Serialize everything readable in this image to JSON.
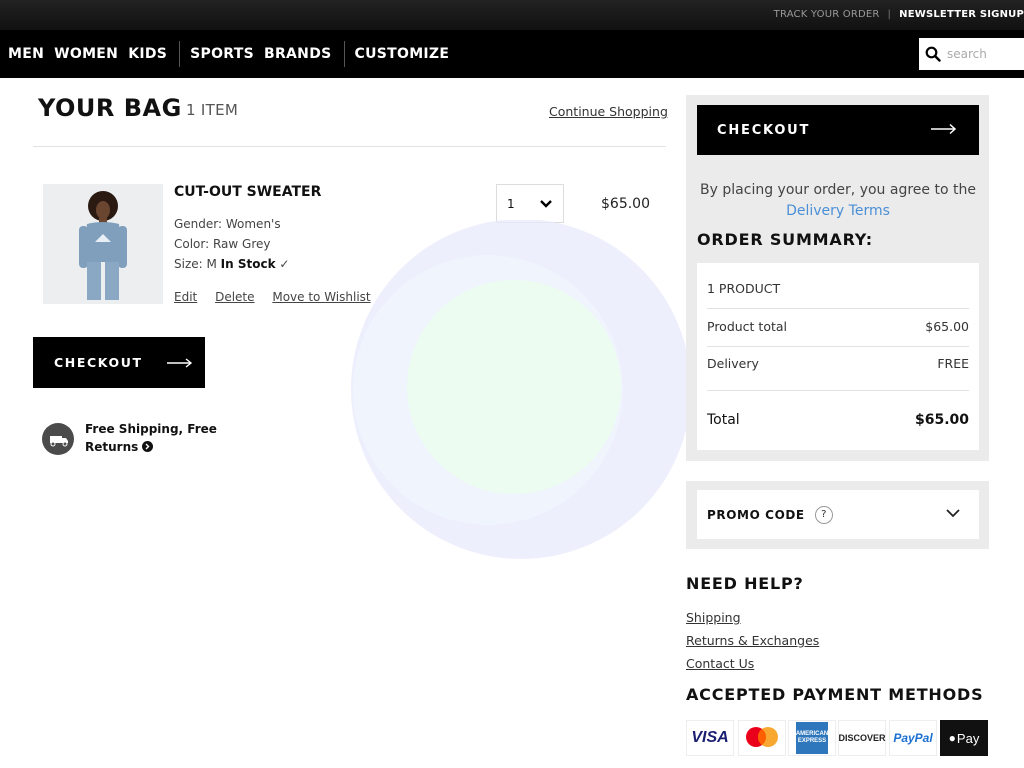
{
  "util": {
    "track_order": "TRACK YOUR ORDER",
    "separator": "|",
    "newsletter": "NEWSLETTER SIGNUP"
  },
  "nav": {
    "group1": [
      "MEN",
      "WOMEN",
      "KIDS"
    ],
    "group2": [
      "SPORTS",
      "BRANDS"
    ],
    "group3": [
      "CUSTOMIZE"
    ]
  },
  "search": {
    "placeholder": "search"
  },
  "bag": {
    "title": "YOUR BAG",
    "count": "1 ITEM",
    "continue": "Continue Shopping"
  },
  "product": {
    "name": "CUT-OUT SWEATER",
    "gender": "Gender: Women's",
    "color": "Color: Raw Grey",
    "size": "Size: M",
    "stock": "In Stock",
    "stock_check": "✓",
    "actions": {
      "edit": "Edit",
      "delete": "Delete",
      "wishlist": "Move to Wishlist"
    },
    "quantity": "1",
    "price": "$65.00"
  },
  "checkout_label": "CHECKOUT",
  "shipping": {
    "line1": "Free Shipping, Free",
    "line2": "Returns"
  },
  "summary": {
    "agree_prefix": "By placing your order, you agree to the",
    "agree_link": "Delivery Terms",
    "title": "ORDER SUMMARY:",
    "products": "1 PRODUCT",
    "rows": [
      {
        "label": "Product total",
        "value": "$65.00"
      },
      {
        "label": "Delivery",
        "value": "FREE"
      }
    ],
    "total_label": "Total",
    "total_value": "$65.00"
  },
  "promo": {
    "label": "PROMO CODE",
    "help": "?"
  },
  "help": {
    "title": "NEED HELP?",
    "links": [
      "Shipping",
      "Returns & Exchanges",
      "Contact Us"
    ]
  },
  "payment": {
    "title": "ACCEPTED PAYMENT METHODS",
    "visa": "VISA",
    "amex": "AMERICAN EXPRESS",
    "discover": "DISCOVER",
    "paypal": "PayPal",
    "applepay": "Pay"
  },
  "colors": {
    "accent_link": "#4a8fd6",
    "panel_bg": "#ebebeb",
    "button_bg": "#000000"
  }
}
